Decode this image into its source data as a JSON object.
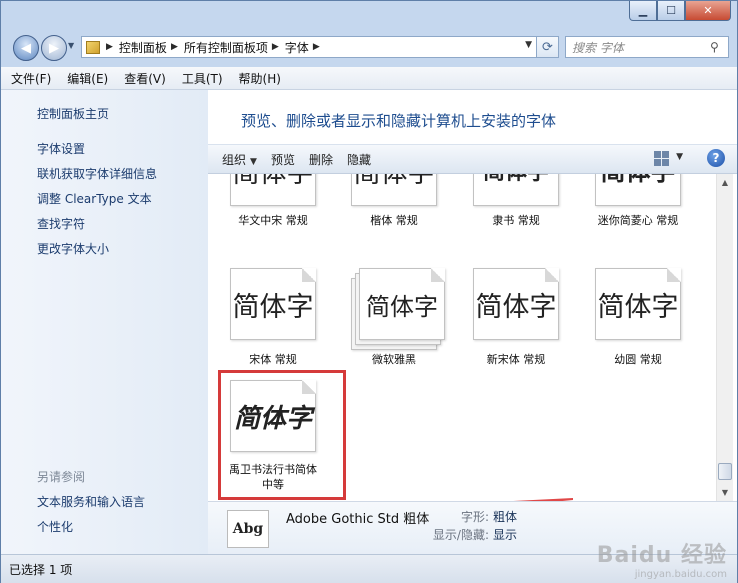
{
  "navbar": {
    "breadcrumbs": [
      "控制面板",
      "所有控制面板项",
      "字体"
    ],
    "search_placeholder": "搜索 字体"
  },
  "menu": [
    "文件(F)",
    "编辑(E)",
    "查看(V)",
    "工具(T)",
    "帮助(H)"
  ],
  "sidebar": {
    "home": "控制面板主页",
    "links": [
      "字体设置",
      "联机获取字体详细信息",
      "调整 ClearType 文本",
      "查找字符",
      "更改字体大小"
    ],
    "see_also_heading": "另请参阅",
    "see_also": [
      "文本服务和输入语言",
      "个性化"
    ]
  },
  "main": {
    "title": "预览、删除或者显示和隐藏计算机上安装的字体",
    "toolbar": {
      "organize": "组织",
      "preview": "预览",
      "delete": "删除",
      "hide": "隐藏"
    },
    "fonts": [
      {
        "sample": "简体字",
        "label": "华文中宋 常规"
      },
      {
        "sample": "简体字",
        "label": "楷体 常规"
      },
      {
        "sample": "简体字",
        "label": "隶书 常规"
      },
      {
        "sample": "简体字",
        "label": "迷你简菱心 常规"
      },
      {
        "sample": "简体字",
        "label": "宋体 常规"
      },
      {
        "sample": "简体字",
        "label": "微软雅黑"
      },
      {
        "sample": "简体字",
        "label": "新宋体 常规"
      },
      {
        "sample": "简体字",
        "label": "幼圆 常规"
      },
      {
        "sample": "简体字",
        "label": "禹卫书法行书简体 中等"
      }
    ]
  },
  "details": {
    "icon_text": "Abg",
    "font_name": "Adobe Gothic Std 粗体",
    "style_label": "字形:",
    "style_value": "粗体",
    "visibility_label": "显示/隐藏:",
    "visibility_value": "显示"
  },
  "status": {
    "text": "已选择 1 项"
  },
  "watermark": {
    "main": "Baidu 经验",
    "sub": "jingyan.baidu.com"
  },
  "colors": {
    "highlight_box": "#d53a3a",
    "arrow": "#e04848"
  }
}
